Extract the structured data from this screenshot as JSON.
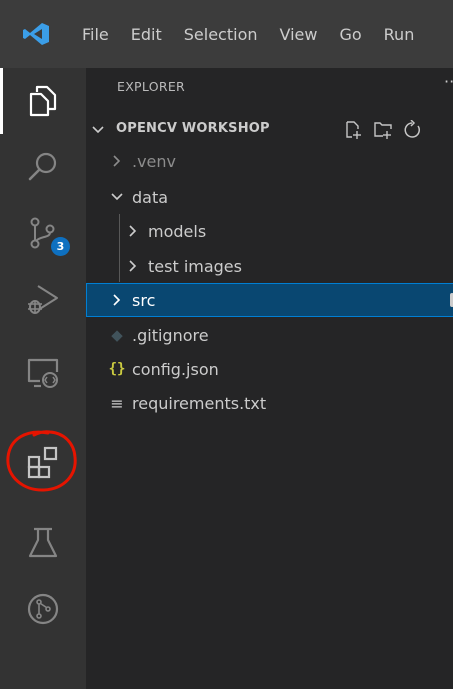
{
  "menu": {
    "items": [
      "File",
      "Edit",
      "Selection",
      "View",
      "Go",
      "Run"
    ]
  },
  "activity_bar": {
    "icons": [
      "explorer-icon",
      "search-icon",
      "source-control-icon",
      "run-debug-icon",
      "remote-explorer-icon",
      "extensions-icon",
      "testing-icon",
      "git-graph-icon"
    ],
    "source_control_badge": "3",
    "highlight_color": "#e51400"
  },
  "explorer": {
    "title": "EXPLORER",
    "more": "···",
    "section_title": "OPENCV WORKSHOP",
    "tree": [
      {
        "label": ".venv",
        "type": "folder",
        "expanded": false
      },
      {
        "label": "data",
        "type": "folder",
        "expanded": true
      },
      {
        "label": "models",
        "type": "folder",
        "expanded": false
      },
      {
        "label": "test images",
        "type": "folder",
        "expanded": false
      },
      {
        "label": "src",
        "type": "folder",
        "expanded": false,
        "selected": true
      },
      {
        "label": ".gitignore",
        "type": "file"
      },
      {
        "label": "config.json",
        "type": "file"
      },
      {
        "label": "requirements.txt",
        "type": "file"
      }
    ],
    "json_icon_glyph": "{}",
    "txt_icon_glyph": "≡",
    "gitignore_icon_glyph": "◆"
  },
  "colors": {
    "accent": "#007acc",
    "selection": "#094771",
    "badge": "#0e70c0"
  }
}
